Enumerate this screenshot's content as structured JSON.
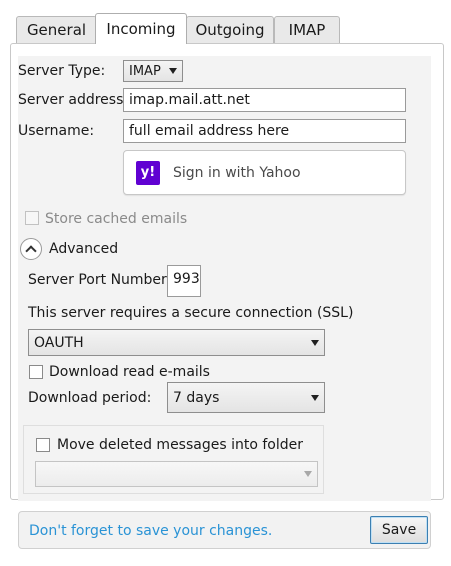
{
  "tabs": [
    {
      "label": "General",
      "active": false
    },
    {
      "label": "Incoming",
      "active": true
    },
    {
      "label": "Outgoing",
      "active": false
    },
    {
      "label": "IMAP",
      "active": false
    }
  ],
  "server_type": {
    "label": "Server Type:",
    "value": "IMAP"
  },
  "server_address": {
    "label": "Server address:",
    "value": "imap.mail.att.net"
  },
  "username": {
    "label": "Username:",
    "value": "full email address here"
  },
  "yahoo_button": {
    "label": "Sign in with Yahoo",
    "logo_text": "y!",
    "logo_color": "#6001d2"
  },
  "store_cached": {
    "label": "Store cached emails",
    "checked": false,
    "disabled": true
  },
  "advanced": {
    "label": "Advanced",
    "expanded": true
  },
  "port": {
    "label": "Server Port Number:",
    "value": "993"
  },
  "ssl": {
    "label": "This server requires a secure connection (SSL)",
    "value": "OAUTH"
  },
  "download_read": {
    "label": "Download read e-mails",
    "checked": false
  },
  "download_period": {
    "label": "Download period:",
    "value": "7 days"
  },
  "move_deleted": {
    "label": "Move deleted messages into folder",
    "checked": false,
    "folder_value": ""
  },
  "footer": {
    "message": "Don't forget to save your changes.",
    "save_label": "Save",
    "message_color": "#2a93d5"
  }
}
